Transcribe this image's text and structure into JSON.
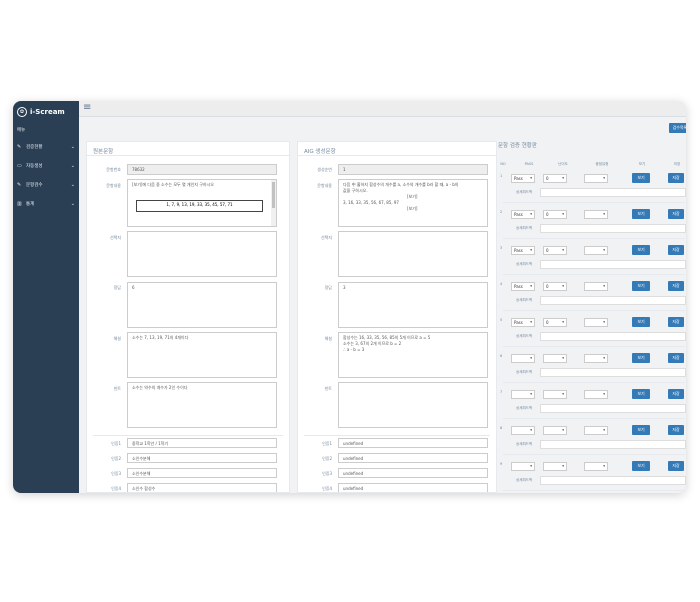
{
  "sidebar": {
    "brand": "i-Scream",
    "logo_icon": "paw-icon",
    "section_title": "메뉴",
    "items": [
      {
        "label": "검증현황",
        "icon": "edit-icon"
      },
      {
        "label": "자동생성",
        "icon": "desktop-icon"
      },
      {
        "label": "문항검수",
        "icon": "edit-icon"
      },
      {
        "label": "통계",
        "icon": "bar-chart-icon"
      }
    ]
  },
  "topbar": {
    "action_button": "검수목록"
  },
  "original": {
    "title": "원본문항",
    "fields": {
      "id_label": "문항번호",
      "id_value": "78632",
      "content_label": "문항내용",
      "content_text": "[보기]에 다음 중 소수는 모두 몇 개인지 구하시오",
      "content_box": "1,  7,  9,  13,  19,  33,  35,  45,  57,  71",
      "choices_label": "선택지",
      "choices_value": "",
      "answer_label": "정답",
      "answer_value": "6",
      "explain_label": "해설",
      "explain_value": "소수는 7, 13, 19, 71의 4개이다",
      "hint_label": "힌트",
      "hint_value": "소수는 약수의 개수가 2인 수이다",
      "cond1_label": "인증1",
      "cond1_value": "중학교 1학년 / 1학기",
      "cond2_label": "인증2",
      "cond2_value": "소인수분해",
      "cond3_label": "인증3",
      "cond3_value": "소인수분해",
      "cond4_label": "인증4",
      "cond4_value": "소인수 합성수"
    }
  },
  "generated": {
    "title": "AIG 생성문항",
    "fields": {
      "id_label": "생성순번",
      "id_value": "1",
      "content_label": "문항내용",
      "content_line1": "다음 中 홀하지 합성수의 개수를 a, 소수의 개수를 b라 할 때, a - b의",
      "content_line2": "값을 구하시오.",
      "content_bracket1": "[보기]",
      "content_numbers": "3,  16,  33,  35,  56,  67,  85,  97",
      "content_bracket2": "[보기]",
      "choices_label": "선택지",
      "choices_value": "",
      "answer_label": "정답",
      "answer_value": "3",
      "explain_label": "해설",
      "explain_line1": "합성수는 16, 33, 35, 56, 85의 5개 이므로 a = 5",
      "explain_line2": "소수는 3, 67의 2개 이므로 b = 2",
      "explain_line3": "∴ a - b = 3",
      "hint_label": "힌트",
      "hint_value": "",
      "cond1_label": "인증1",
      "cond1_value": "undefined",
      "cond2_label": "인증2",
      "cond2_value": "undefined",
      "cond3_label": "인증3",
      "cond3_value": "undefined",
      "cond4_label": "인증4",
      "cond4_value": "undefined"
    }
  },
  "review": {
    "title": "문항 검증 현황판",
    "headers": [
      "NO",
      "PASS",
      "난이도",
      "중점유형",
      "보기",
      "저장"
    ],
    "feedback_label": "상세피드백",
    "view_label": "보기",
    "save_label": "저장",
    "rows": [
      {
        "no": "1",
        "pass": "Pass",
        "level": "0"
      },
      {
        "no": "2",
        "pass": "Pass",
        "level": "0"
      },
      {
        "no": "3",
        "pass": "Pass",
        "level": "0"
      },
      {
        "no": "4",
        "pass": "Pass",
        "level": "0"
      },
      {
        "no": "5",
        "pass": "Pass",
        "level": "0"
      },
      {
        "no": "6",
        "pass": "",
        "level": ""
      },
      {
        "no": "7",
        "pass": "",
        "level": ""
      },
      {
        "no": "8",
        "pass": "",
        "level": ""
      },
      {
        "no": "9",
        "pass": "",
        "level": ""
      }
    ]
  },
  "colors": {
    "sidebar": "#2a3f54",
    "primary_button": "#337ab7"
  }
}
